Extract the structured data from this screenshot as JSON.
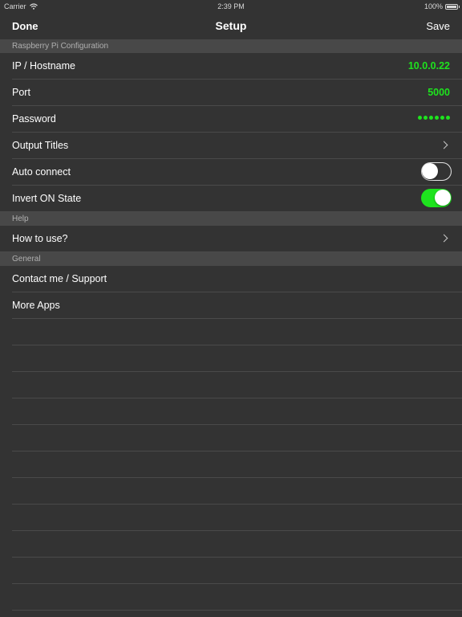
{
  "status_bar": {
    "carrier": "Carrier",
    "time": "2:39 PM",
    "battery_pct": "100%",
    "battery_level": 1.0
  },
  "nav": {
    "done_label": "Done",
    "title": "Setup",
    "save_label": "Save"
  },
  "sections": {
    "raspberry": {
      "header": "Raspberry Pi Configuration",
      "ip_label": "IP / Hostname",
      "ip_value": "10.0.0.22",
      "port_label": "Port",
      "port_value": "5000",
      "password_label": "Password",
      "password_length": 6,
      "output_titles_label": "Output Titles",
      "auto_connect_label": "Auto connect",
      "auto_connect_on": false,
      "invert_label": "Invert ON State",
      "invert_on": true
    },
    "help": {
      "header": "Help",
      "how_to_label": "How to use?"
    },
    "general": {
      "header": "General",
      "contact_label": "Contact me / Support",
      "more_apps_label": "More Apps"
    }
  },
  "colors": {
    "accent_green": "#1ee31e",
    "background": "#333333",
    "section_header_bg": "#484848"
  }
}
